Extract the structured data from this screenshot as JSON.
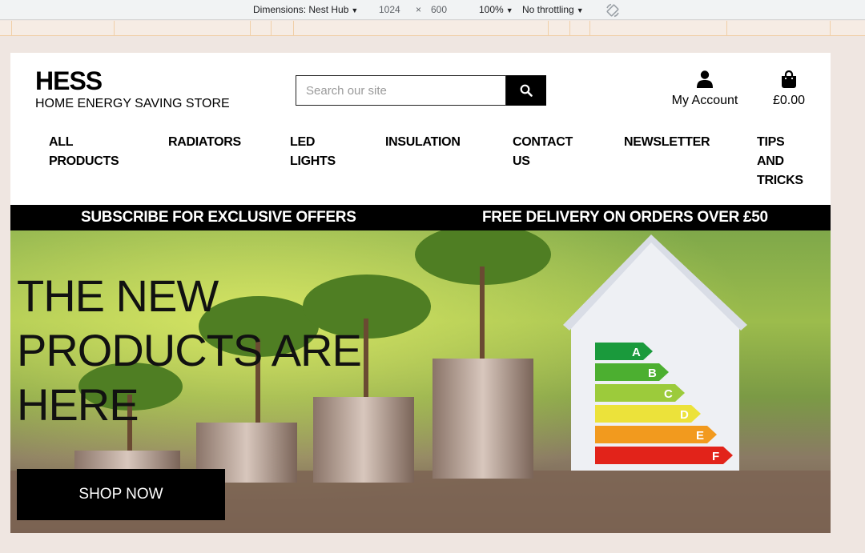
{
  "devtools": {
    "dimensions_label": "Dimensions: Nest Hub",
    "width": "1024",
    "times": "×",
    "height": "600",
    "zoom": "100%",
    "throttling": "No throttling"
  },
  "site": {
    "brand_name": "HESS",
    "brand_tagline": "HOME ENERGY SAVING STORE",
    "search_placeholder": "Search our site",
    "account_label": "My Account",
    "cart_total": "£0.00",
    "nav": [
      {
        "line1": "ALL",
        "line2": "PRODUCTS",
        "line3": ""
      },
      {
        "line1": "RADIATORS",
        "line2": "",
        "line3": ""
      },
      {
        "line1": "LED",
        "line2": "LIGHTS",
        "line3": ""
      },
      {
        "line1": "INSULATION",
        "line2": "",
        "line3": ""
      },
      {
        "line1": "CONTACT",
        "line2": "US",
        "line3": ""
      },
      {
        "line1": "NEWSLETTER",
        "line2": "",
        "line3": ""
      },
      {
        "line1": "TIPS",
        "line2": "AND",
        "line3": "TRICKS"
      }
    ],
    "promo_left": "SUBSCRIBE FOR EXCLUSIVE OFFERS",
    "promo_right": "FREE DELIVERY ON ORDERS OVER £50",
    "hero_line1": "THE NEW",
    "hero_line2": "PRODUCTS ARE",
    "hero_line3": "HERE",
    "shop_button": "SHOP NOW",
    "energy_ratings": [
      "A",
      "B",
      "C",
      "D",
      "E",
      "F"
    ],
    "energy_colors": [
      "#1a9a3c",
      "#4caf30",
      "#9ccb3b",
      "#ece23a",
      "#f29a1e",
      "#e2231a"
    ]
  }
}
